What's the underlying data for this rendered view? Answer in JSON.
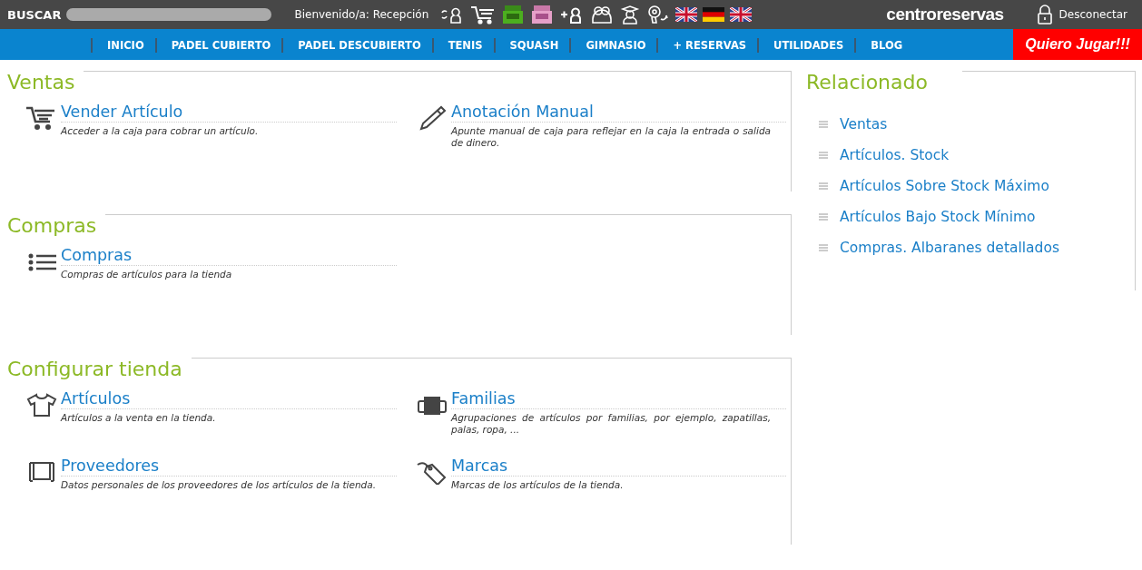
{
  "topbar": {
    "search_label": "BUSCAR",
    "welcome": "Bienvenido/a: Recepción",
    "logo": "centroreservas",
    "logout": "Desconectar"
  },
  "nav": {
    "items": [
      "INICIO",
      "PADEL CUBIERTO",
      "PADEL DESCUBIERTO",
      "TENIS",
      "SQUASH",
      "GIMNASIO",
      "+ RESERVAS",
      "UTILIDADES",
      "BLOG"
    ],
    "cta": "Quiero Jugar!!!"
  },
  "sections": [
    {
      "title": "Ventas",
      "items": [
        {
          "title": "Vender Artículo",
          "description": "Acceder a la caja para cobrar un artículo."
        },
        {
          "title": "Anotación Manual",
          "description": "Apunte manual de caja para reflejar en la caja la entrada o salida de dinero."
        }
      ]
    },
    {
      "title": "Compras",
      "items": [
        {
          "title": "Compras",
          "description": "Compras de artículos para la tienda"
        }
      ]
    },
    {
      "title": "Configurar tienda",
      "items": [
        {
          "title": "Artículos",
          "description": "Artículos a la venta en la tienda."
        },
        {
          "title": "Familias",
          "description": "Agrupaciones de artículos por familias, por ejemplo, zapatillas, palas, ropa, ..."
        },
        {
          "title": "Proveedores",
          "description": "Datos personales de los proveedores de los artículos de la tienda."
        },
        {
          "title": "Marcas",
          "description": "Marcas de los artículos de la tienda."
        }
      ]
    }
  ],
  "related": {
    "title": "Relacionado",
    "links": [
      "Ventas",
      "Artículos. Stock",
      "Artículos Sobre Stock Máximo",
      "Artículos Bajo Stock Mínimo",
      "Compras. Albaranes detallados"
    ]
  }
}
